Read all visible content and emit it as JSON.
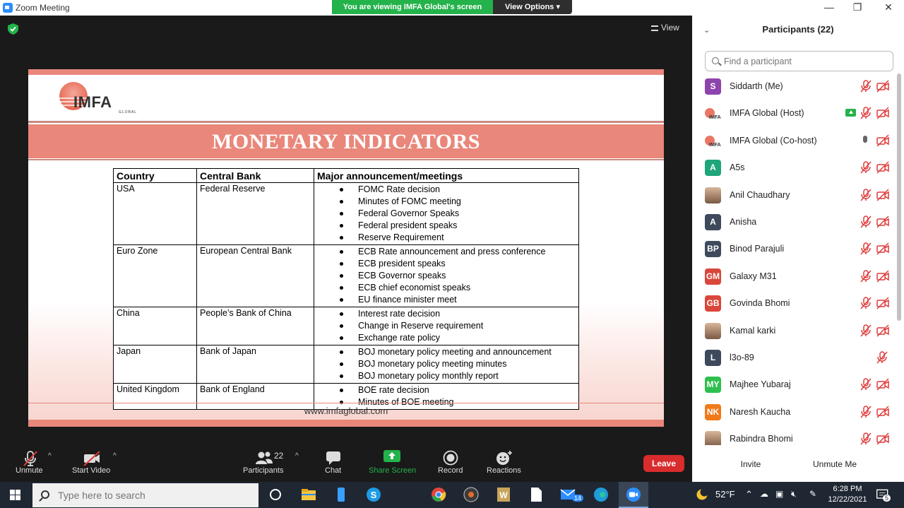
{
  "window": {
    "title": "Zoom Meeting",
    "viewing_banner": "You are viewing IMFA Global's screen",
    "view_options": "View Options",
    "minimize": "—",
    "restore": "❐",
    "close": "✕"
  },
  "meeting": {
    "view_label": "View"
  },
  "slide": {
    "logo_text": "IMFA",
    "logo_sub": "GLOBAL",
    "title": "MONETARY INDICATORS",
    "website": "www.imfaglobal.com",
    "table": {
      "headers": [
        "Country",
        "Central Bank",
        "Major announcement/meetings"
      ],
      "rows": [
        {
          "country": "USA",
          "bank": "Federal Reserve",
          "items": [
            "FOMC Rate decision",
            "Minutes of FOMC meeting",
            "Federal Governor Speaks",
            "Federal president speaks",
            "Reserve Requirement"
          ]
        },
        {
          "country": "Euro Zone",
          "bank": "European Central Bank",
          "items": [
            "ECB Rate announcement and press conference",
            "ECB president speaks",
            "ECB Governor speaks",
            "ECB chief economist speaks",
            "EU finance minister meet"
          ]
        },
        {
          "country": "China",
          "bank": "People’s Bank of China",
          "items": [
            "Interest rate decision",
            "Change  in Reserve requirement",
            "Exchange rate policy"
          ]
        },
        {
          "country": "Japan",
          "bank": "Bank of Japan",
          "items": [
            "BOJ monetary policy meeting and announcement",
            "BOJ monetary policy meeting minutes",
            "BOJ monetary policy monthly report"
          ]
        },
        {
          "country": "United Kingdom",
          "bank": "Bank of England",
          "items": [
            "BOE rate decision",
            "Minutes of BOE meeting"
          ]
        }
      ]
    }
  },
  "toolbar": {
    "unmute": "Unmute",
    "start_video": "Start Video",
    "participants": "Participants",
    "participants_count": "22",
    "chat": "Chat",
    "share_screen": "Share Screen",
    "record": "Record",
    "reactions": "Reactions",
    "leave": "Leave"
  },
  "panel": {
    "title": "Participants (22)",
    "search_placeholder": "Find a participant",
    "invite": "Invite",
    "unmute_me": "Unmute Me",
    "participants": [
      {
        "name": "Siddarth (Me)",
        "initials": "S",
        "color": "#8e44ad",
        "kind": "initials",
        "cam": true
      },
      {
        "name": "IMFA Global (Host)",
        "initials": "",
        "color": "#ffffff",
        "kind": "logo",
        "cam": true,
        "sharing": true
      },
      {
        "name": "IMFA Global (Co-host)",
        "initials": "",
        "color": "#ffffff",
        "kind": "logo",
        "cam": true,
        "mic_on": true
      },
      {
        "name": "A5s",
        "initials": "A",
        "color": "#1fa57a",
        "kind": "initials",
        "cam": true
      },
      {
        "name": "Anil Chaudhary",
        "initials": "",
        "color": "#a07a5e",
        "kind": "photo",
        "cam": true
      },
      {
        "name": "Anisha",
        "initials": "A",
        "color": "#3e4a5c",
        "kind": "initials",
        "cam": true
      },
      {
        "name": "Binod Parajuli",
        "initials": "BP",
        "color": "#3e4a5c",
        "kind": "initials",
        "cam": true
      },
      {
        "name": "Galaxy M31",
        "initials": "GM",
        "color": "#d9473a",
        "kind": "initials",
        "cam": true
      },
      {
        "name": "Govinda Bhomi",
        "initials": "GB",
        "color": "#d9473a",
        "kind": "initials",
        "cam": true
      },
      {
        "name": "Kamal karki",
        "initials": "",
        "color": "#a07a5e",
        "kind": "photo",
        "cam": true
      },
      {
        "name": "l3o-89",
        "initials": "L",
        "color": "#3e4a5c",
        "kind": "initials",
        "cam": false
      },
      {
        "name": "Majhee Yubaraj",
        "initials": "MY",
        "color": "#2fbf4e",
        "kind": "initials",
        "cam": true
      },
      {
        "name": "Naresh Kaucha",
        "initials": "NK",
        "color": "#f07a1a",
        "kind": "initials",
        "cam": true
      },
      {
        "name": "Rabindra Bhomi",
        "initials": "",
        "color": "#a07a5e",
        "kind": "photo",
        "cam": true
      }
    ]
  },
  "taskbar": {
    "search_placeholder": "Type here to search",
    "weather": "52°F",
    "time": "6:28 PM",
    "date": "12/22/2021",
    "mail_badge": "14",
    "notif_badge": "5"
  },
  "colors": {
    "brand": "#e9877a",
    "zoom_green": "#24b24b",
    "leave_red": "#d92c2c"
  }
}
